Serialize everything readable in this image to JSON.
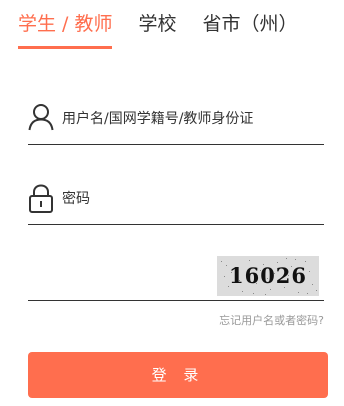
{
  "tabs": [
    {
      "label": "学生 / 教师",
      "active": true
    },
    {
      "label": "学校",
      "active": false
    },
    {
      "label": "省市（州）",
      "active": false
    }
  ],
  "username": {
    "placeholder": "用户名/国网学籍号/教师身份证",
    "value": "",
    "icon": "user-icon"
  },
  "password": {
    "placeholder": "密码",
    "value": "",
    "icon": "lock-icon"
  },
  "captcha": {
    "code": "16026",
    "input_value": ""
  },
  "forgot_link": "忘记用户名或者密码?",
  "login_button": "登 录",
  "colors": {
    "accent": "#ff6e4e",
    "text": "#333333",
    "muted": "#999999"
  }
}
